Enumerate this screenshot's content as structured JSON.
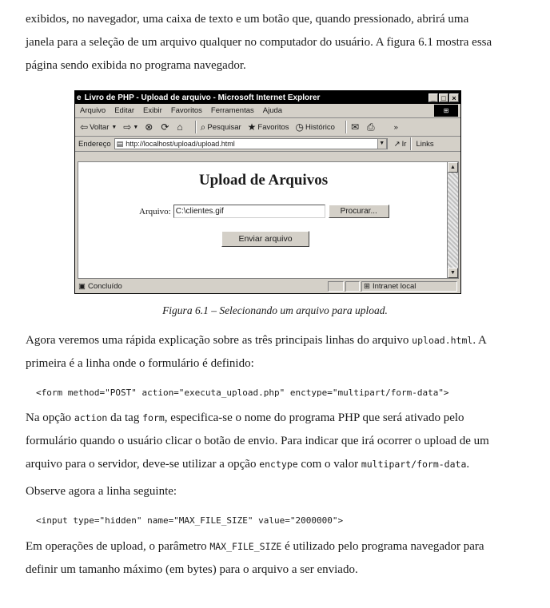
{
  "intro": {
    "line1": "exibidos, no navegador, uma caixa de texto e um botão que, quando pressionado, abrirá uma",
    "line2": "janela para a seleção de um arquivo qualquer no computador do usuário. A figura 6.1 mostra essa",
    "line3": "página sendo exibida no programa navegador."
  },
  "figure": {
    "window_title": "Livro de PHP - Upload de arquivo - Microsoft Internet Explorer",
    "window_buttons": [
      "_",
      "□",
      "×"
    ],
    "menu": [
      "Arquivo",
      "Editar",
      "Exibir",
      "Favoritos",
      "Ferramentas",
      "Ajuda"
    ],
    "toolbar": {
      "back": "Voltar",
      "search": "Pesquisar",
      "favorites": "Favoritos",
      "history": "Histórico"
    },
    "address": {
      "label": "Endereço",
      "url": "http://localhost/upload/upload.html",
      "go": "Ir",
      "links": "Links"
    },
    "page": {
      "heading": "Upload de Arquivos",
      "file_label": "Arquivo:",
      "file_value": "C:\\clientes.gif",
      "browse_button": "Procurar...",
      "submit_button": "Enviar arquivo"
    },
    "status": {
      "text": "Concluído",
      "zone": "Intranet local"
    }
  },
  "caption": "Figura 6.1 – Selecionando um arquivo para upload.",
  "body": {
    "p1_a": "Agora veremos uma rápida explicação sobre as três principais linhas do arquivo ",
    "p1_code": "upload.html",
    "p1_b": ". A",
    "p1_line2": "primeira é a linha onde o formulário é definido:",
    "code1": "<form method=\"POST\" action=\"executa_upload.php\" enctype=\"multipart/form-data\">",
    "p2_a": "Na opção ",
    "p2_code1": "action",
    "p2_b": " da tag ",
    "p2_code2": "form",
    "p2_c": ", especifica-se o nome do programa PHP que será ativado pelo",
    "p2_line2": "formulário quando o usuário clicar o botão de envio. Para indicar que irá ocorrer o upload de um",
    "p2_line3_a": "arquivo para o servidor, deve-se utilizar a opção ",
    "p2_code3": "enctype",
    "p2_line3_b": " com o valor ",
    "p2_code4": "multipart/form-data",
    "p2_line3_c": ".",
    "p3": "Observe agora a linha seguinte:",
    "code2": "<input type=\"hidden\" name=\"MAX_FILE_SIZE\" value=\"2000000\">",
    "p4_a": "Em operações de upload, o parâmetro ",
    "p4_code": "MAX_FILE_SIZE",
    "p4_b": " é utilizado pelo programa navegador para",
    "p4_line2": "definir um tamanho máximo (em bytes) para o arquivo a ser enviado."
  }
}
